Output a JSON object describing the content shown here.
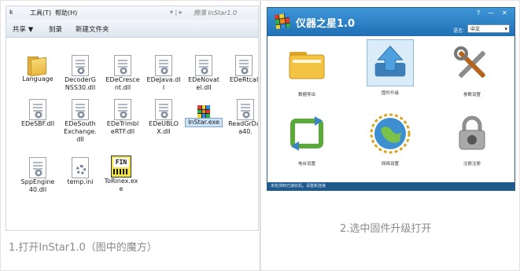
{
  "captions": {
    "left": "1.打开InStar1.0（图中的魔方）",
    "right": "2.选中固件升级打开"
  },
  "explorer": {
    "menu": [
      "k",
      "工具(T)",
      "帮助(H)"
    ],
    "address_text": "腾落 InStar1.0",
    "toolbar": [
      "共享 ▼",
      "刻录",
      "新建文件夹"
    ],
    "files": [
      {
        "name": "Language",
        "icon": "folder-icon"
      },
      {
        "name": "DecoderGNSS30.dll",
        "icon": "dll-file-icon"
      },
      {
        "name": "EDeCrescent.dll",
        "icon": "dll-file-icon"
      },
      {
        "name": "EDeJava.dll",
        "icon": "dll-file-icon"
      },
      {
        "name": "EDeNovatel.dll",
        "icon": "dll-file-icon"
      },
      {
        "name": "EDeRtcal",
        "icon": "dll-file-icon"
      },
      {
        "name": "EDeSBF.dll",
        "icon": "dll-file-icon"
      },
      {
        "name": "EDeSouthExchange.dll",
        "icon": "dll-file-icon"
      },
      {
        "name": "EDeTrimbleRTF.dll",
        "icon": "dll-file-icon"
      },
      {
        "name": "EDeUBLOX.dll",
        "icon": "dll-file-icon"
      },
      {
        "name": "InStar.exe",
        "icon": "rubiks-cube-icon",
        "selected": true
      },
      {
        "name": "ReadGrData40.",
        "icon": "dll-file-icon"
      },
      {
        "name": "SppEngine40.dll",
        "icon": "dll-file-icon"
      },
      {
        "name": "temp.ini",
        "icon": "settings-file-icon"
      },
      {
        "name": "ToRinex.exe",
        "icon": "rinex-converter-icon"
      }
    ]
  },
  "app": {
    "title": "仪器之星1.0",
    "window_buttons": [
      "?",
      "—",
      "✕"
    ],
    "language_label": "语言：",
    "language_value": "中文",
    "tiles": [
      {
        "label": "数据导出",
        "icon": "folder-icon"
      },
      {
        "label": "固件升级",
        "icon": "upload-arrow-icon",
        "selected": true
      },
      {
        "label": "参数设置",
        "icon": "tools-icon"
      },
      {
        "label": "电台设置",
        "icon": "refresh-arrows-icon"
      },
      {
        "label": "网络设置",
        "icon": "globe-network-icon"
      },
      {
        "label": "注册注册",
        "icon": "padlock-icon"
      }
    ],
    "status_text": "未检测到已接收机。请重新连接",
    "colors": {
      "title_bar": "#2a7fc6",
      "status_bar": "#1f5a8c",
      "selection": "#cde3f8"
    }
  }
}
